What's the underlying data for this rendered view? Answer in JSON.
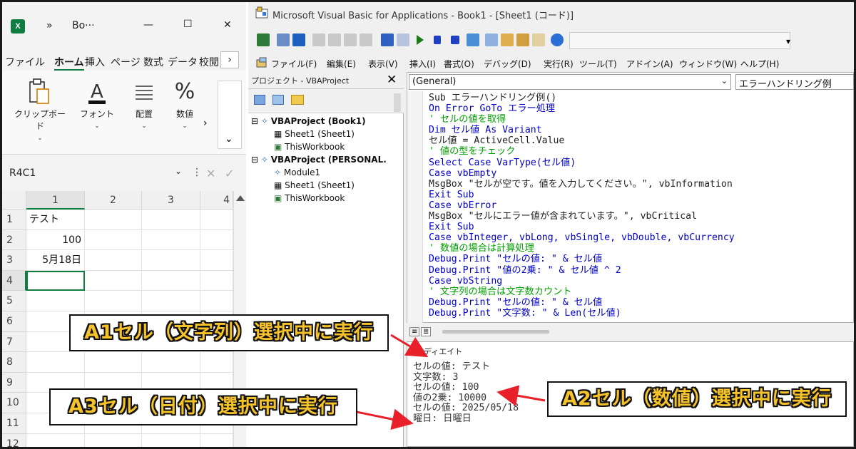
{
  "excel": {
    "logo_text": "X",
    "title_chevron": "»",
    "title": "Bo···",
    "window_controls": {
      "minimize": "—",
      "maximize": "☐",
      "close": "✕"
    },
    "tabs": [
      "ファイル",
      "ホーム",
      "挿入",
      "ページ",
      "数式",
      "データ",
      "校閲"
    ],
    "tabs_more": "›",
    "ribbon_groups": [
      {
        "label": "クリップボード",
        "icon": "clipboard-icon"
      },
      {
        "label": "フォント",
        "icon": "font-icon"
      },
      {
        "label": "配置",
        "icon": "align-icon"
      },
      {
        "label": "数値",
        "icon": "percent-icon"
      }
    ],
    "ribbon_more": "›",
    "ribbon_collapse": "⌄",
    "name_box": "R4C1",
    "formula_sep": "⋮",
    "formula_cancel": "✕",
    "formula_enter": "✓",
    "columns": [
      "1",
      "2",
      "3",
      "4"
    ],
    "rows": [
      "1",
      "2",
      "3",
      "4",
      "5",
      "6",
      "7",
      "8",
      "9",
      "10",
      "11",
      "12"
    ],
    "cells": {
      "r1": "テスト",
      "r2": "100",
      "r3": "5月18日"
    },
    "selected_cell": "R4C1"
  },
  "vba": {
    "title": "Microsoft Visual Basic for Applications - Book1 - [Sheet1 (コード)]",
    "menu": [
      "ファイル(F)",
      "編集(E)",
      "表示(V)",
      "挿入(I)",
      "書式(O)",
      "デバッグ(D)",
      "実行(R)",
      "ツール(T)",
      "アドイン(A)",
      "ウィンドウ(W)",
      "ヘルプ(H)"
    ],
    "project_title": "プロジェクト - VBAProject",
    "project_close": "✕",
    "tree": [
      "VBAProject (Book1)",
      "Sheet1 (Sheet1)",
      "ThisWorkbook",
      "VBAProject (PERSONAL.",
      "Module1",
      "Sheet1 (Sheet1)",
      "ThisWorkbook"
    ],
    "combo_general": "(General)",
    "combo_proc": "エラーハンドリング例",
    "code": [
      {
        "t": "Sub エラーハンドリング例()",
        "c": "tx"
      },
      {
        "t": "On Error GoTo エラー処理",
        "c": "kw"
      },
      {
        "t": "' セルの値を取得",
        "c": "cm"
      },
      {
        "t": "Dim セル値 As Variant",
        "c": "kw"
      },
      {
        "t": "セル値 = ActiveCell.Value",
        "c": "tx"
      },
      {
        "t": "' 値の型をチェック",
        "c": "cm"
      },
      {
        "t": "Select Case VarType(セル値)",
        "c": "kw"
      },
      {
        "t": "Case vbEmpty",
        "c": "kw"
      },
      {
        "t": "MsgBox \"セルが空です。値を入力してください。\", vbInformation",
        "c": "tx"
      },
      {
        "t": "Exit Sub",
        "c": "kw"
      },
      {
        "t": "Case vbError",
        "c": "kw"
      },
      {
        "t": "MsgBox \"セルにエラー値が含まれています。\", vbCritical",
        "c": "tx"
      },
      {
        "t": "Exit Sub",
        "c": "kw"
      },
      {
        "t": "Case vbInteger, vbLong, vbSingle, vbDouble, vbCurrency",
        "c": "kw"
      },
      {
        "t": "' 数値の場合は計算処理",
        "c": "cm"
      },
      {
        "t": "Debug.Print \"セルの値: \" & セル値",
        "c": "kw"
      },
      {
        "t": "Debug.Print \"値の2乗: \" & セル値 ^ 2",
        "c": "kw"
      },
      {
        "t": "Case vbString",
        "c": "kw"
      },
      {
        "t": "' 文字列の場合は文字数カウント",
        "c": "cm"
      },
      {
        "t": "Debug.Print \"セルの値: \" & セル値",
        "c": "kw"
      },
      {
        "t": "Debug.Print \"文字数: \" & Len(セル値)",
        "c": "kw"
      }
    ],
    "immediate_title": "イミディエイト",
    "immediate": [
      "セルの値: テスト",
      "文字数: 3",
      "セルの値: 100",
      "値の2乗: 10000",
      "セルの値: 2025/05/18",
      "曜日: 日曜日"
    ]
  },
  "callouts": {
    "a1": "A1セル（文字列）選択中に実行",
    "a2": "A2セル（数値）選択中に実行",
    "a3": "A3セル（日付）選択中に実行"
  },
  "colors": {
    "callout_fill": "#f5c22a",
    "arrow": "#e8202a",
    "keyword": "#0000c8",
    "comment": "#00a000",
    "excel_green": "#107c41"
  }
}
